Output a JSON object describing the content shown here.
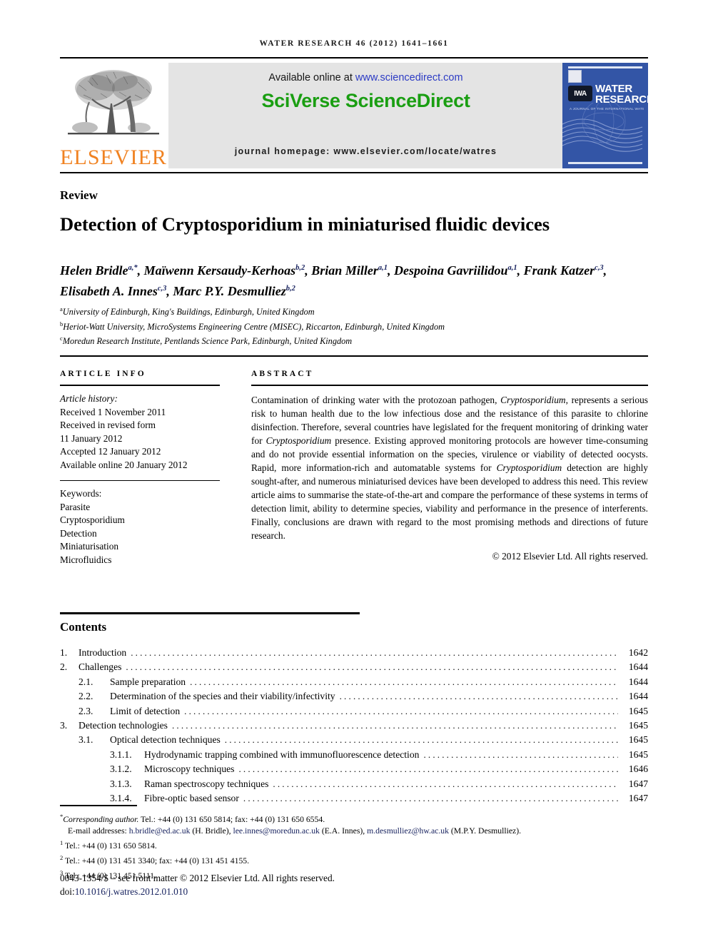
{
  "running_head": "WATER RESEARCH 46 (2012) 1641–1661",
  "masthead": {
    "publisher_name": "ELSEVIER",
    "available_prefix": "Available online at ",
    "available_link": "www.sciencedirect.com",
    "platform_title": "SciVerse ScienceDirect",
    "journal_homepage": "journal homepage: www.elsevier.com/locate/watres",
    "cover": {
      "iwa_label": "IWA",
      "title_line1": "WATER",
      "title_line2": "RESEARCH",
      "subtitle": "A JOURNAL OF THE INTERNATIONAL WATER ASSOCIATION"
    },
    "colors": {
      "elsevier_orange": "#f08221",
      "sciencedirect_green": "#1a9e12",
      "link_blue": "#2c3bc4",
      "cover_blue": "#3355a6",
      "banner_grey": "#e4e4e4"
    }
  },
  "article_type": "Review",
  "title": "Detection of Cryptosporidium in miniaturised fluidic devices",
  "authors": [
    {
      "name": "Helen Bridle",
      "sup": "a,*"
    },
    {
      "name": "Maïwenn Kersaudy-Kerhoas",
      "sup": "b,2"
    },
    {
      "name": "Brian Miller",
      "sup": "a,1"
    },
    {
      "name": "Despoina Gavriilidou",
      "sup": "a,1"
    },
    {
      "name": "Frank Katzer",
      "sup": "c,3"
    },
    {
      "name": "Elisabeth A. Innes",
      "sup": "c,3"
    },
    {
      "name": "Marc P.Y. Desmulliez",
      "sup": "b,2"
    }
  ],
  "affiliations": [
    {
      "marker": "a",
      "text": "University of Edinburgh, King's Buildings, Edinburgh, United Kingdom"
    },
    {
      "marker": "b",
      "text": "Heriot-Watt University, MicroSystems Engineering Centre (MISEC), Riccarton, Edinburgh, United Kingdom"
    },
    {
      "marker": "c",
      "text": "Moredun Research Institute, Pentlands Science Park, Edinburgh, United Kingdom"
    }
  ],
  "article_info": {
    "heading": "ARTICLE INFO",
    "history_label": "Article history:",
    "history": [
      "Received 1 November 2011",
      "Received in revised form",
      "11 January 2012",
      "Accepted 12 January 2012",
      "Available online 20 January 2012"
    ],
    "keywords_label": "Keywords:",
    "keywords": [
      "Parasite",
      "Cryptosporidium",
      "Detection",
      "Miniaturisation",
      "Microfluidics"
    ]
  },
  "abstract": {
    "heading": "ABSTRACT",
    "text_parts": [
      {
        "t": "Contamination of drinking water with the protozoan pathogen, "
      },
      {
        "t": "Cryptosporidium",
        "i": true
      },
      {
        "t": ", represents a serious risk to human health due to the low infectious dose and the resistance of this parasite to chlorine disinfection. Therefore, several countries have legislated for the frequent monitoring of drinking water for "
      },
      {
        "t": "Cryptosporidium",
        "i": true
      },
      {
        "t": " presence. Existing approved monitoring protocols are however time-consuming and do not provide essential information on the species, virulence or viability of detected oocysts. Rapid, more information-rich and automatable systems for "
      },
      {
        "t": "Cryptosporidium",
        "i": true
      },
      {
        "t": " detection are highly sought-after, and numerous miniaturised devices have been developed to address this need. This review article aims to summarise the state-of-the-art and compare the performance of these systems in terms of detection limit, ability to determine species, viability and performance in the presence of interferents. Finally, conclusions are drawn with regard to the most promising methods and directions of future research."
      }
    ],
    "copyright": "© 2012 Elsevier Ltd. All rights reserved."
  },
  "contents": {
    "heading": "Contents",
    "entries": [
      {
        "num": "1.",
        "level": 1,
        "label": "Introduction",
        "page": "1642"
      },
      {
        "num": "2.",
        "level": 1,
        "label": "Challenges",
        "page": "1644"
      },
      {
        "num": "2.1.",
        "level": 2,
        "label": "Sample preparation",
        "page": "1644"
      },
      {
        "num": "2.2.",
        "level": 2,
        "label": "Determination of the species and their viability/infectivity",
        "page": "1644"
      },
      {
        "num": "2.3.",
        "level": 2,
        "label": "Limit of detection",
        "page": "1645"
      },
      {
        "num": "3.",
        "level": 1,
        "label": "Detection technologies",
        "page": "1645"
      },
      {
        "num": "3.1.",
        "level": 2,
        "label": "Optical detection techniques",
        "page": "1645"
      },
      {
        "num": "3.1.1.",
        "level": 3,
        "label": "Hydrodynamic trapping combined with immunofluorescence detection",
        "page": "1645"
      },
      {
        "num": "3.1.2.",
        "level": 3,
        "label": "Microscopy techniques",
        "page": "1646"
      },
      {
        "num": "3.1.3.",
        "level": 3,
        "label": "Raman spectroscopy techniques",
        "page": "1647"
      },
      {
        "num": "3.1.4.",
        "level": 3,
        "label": "Fibre-optic based sensor",
        "page": "1647"
      }
    ]
  },
  "footnotes": {
    "corresponding": {
      "marker": "*",
      "italic_part": "Corresponding author.",
      "rest": " Tel.: +44 (0) 131 650 5814; fax: +44 (0) 131 650 6554."
    },
    "emails": {
      "label": "E-mail addresses: ",
      "items": [
        {
          "address": "h.bridle@ed.ac.uk",
          "owner": " (H. Bridle), "
        },
        {
          "address": "lee.innes@moredun.ac.uk",
          "owner": " (E.A. Innes), "
        },
        {
          "address": "m.desmulliez@hw.ac.uk",
          "owner": " (M.P.Y. Desmulliez)."
        }
      ]
    },
    "numbered": [
      {
        "marker": "1",
        "text": "Tel.: +44 (0) 131 650 5814."
      },
      {
        "marker": "2",
        "text": "Tel.: +44 (0) 131 451 3340; fax: +44 (0) 131 451 4155."
      },
      {
        "marker": "3",
        "text": "Tel.: +44 (0) 131 451 5111."
      }
    ]
  },
  "front_matter": {
    "issn_line": "0043-1354/$ – see front matter © 2012 Elsevier Ltd. All rights reserved.",
    "doi_label": "doi:",
    "doi_value": "10.1016/j.watres.2012.01.010"
  }
}
